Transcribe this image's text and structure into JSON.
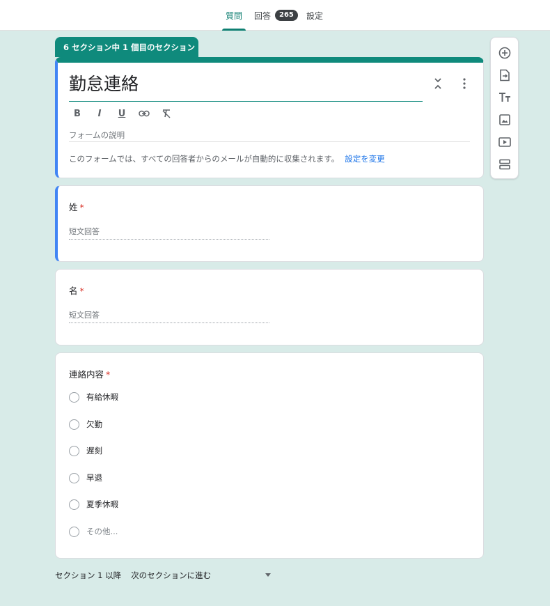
{
  "tabs": {
    "questions": "質問",
    "responses": "回答",
    "responses_count": "265",
    "settings": "設定"
  },
  "section": {
    "tag": "6 セクション中 1 個目のセクション"
  },
  "form": {
    "title": "勤怠連絡",
    "description_placeholder": "フォームの説明",
    "notice": "このフォームでは、すべての回答者からのメールが自動的に収集されます。",
    "notice_link": "設定を変更"
  },
  "format_icons": [
    "bold-icon",
    "italic-icon",
    "underline-icon",
    "link-icon",
    "clear-format-icon"
  ],
  "questions": [
    {
      "label": "姓",
      "required": "*",
      "placeholder": "短文回答"
    },
    {
      "label": "名",
      "required": "*",
      "placeholder": "短文回答"
    },
    {
      "label": "連絡内容",
      "required": "*",
      "options": [
        "有給休暇",
        "欠勤",
        "遅刻",
        "早退",
        "夏季休暇"
      ],
      "other": "その他..."
    }
  ],
  "toolbar_icons": [
    "add-question-icon",
    "import-questions-icon",
    "add-title-icon",
    "add-image-icon",
    "add-video-icon",
    "add-section-icon"
  ],
  "footer": {
    "label": "セクション 1 以降",
    "select_value": "次のセクションに進む"
  },
  "colors": {
    "accent": "#0f8a7c",
    "background": "#d8ebe8",
    "focus_bar": "#4285f4",
    "link": "#1a73e8",
    "required": "#d93025"
  }
}
